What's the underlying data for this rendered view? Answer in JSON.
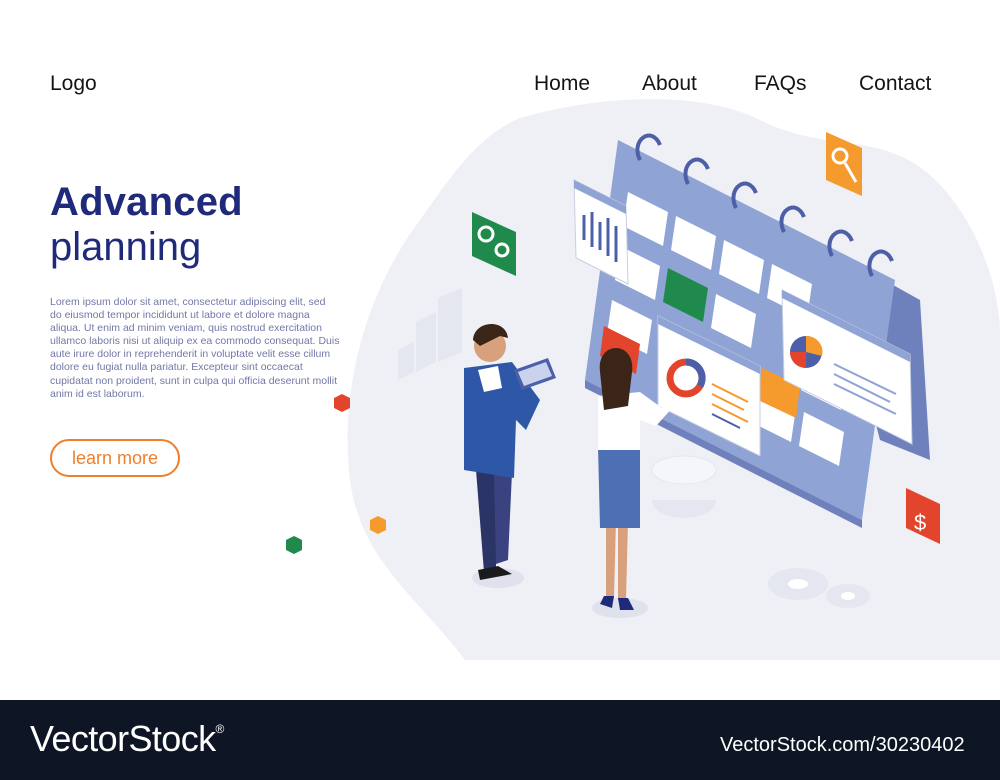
{
  "nav": {
    "logo": "Logo",
    "items": [
      "Home",
      "About",
      "FAQs",
      "Contact"
    ]
  },
  "hero": {
    "title_line1": "Advanced",
    "title_line2": "planning",
    "body": "Lorem ipsum dolor sit amet, consectetur adipiscing elit, sed do eiusmod tempor incididunt ut labore et dolore magna aliqua. Ut enim ad minim veniam, quis nostrud exercitation ullamco laboris nisi ut aliquip ex ea commodo consequat. Duis aute irure dolor in reprehenderit in voluptate velit esse cillum dolore eu fugiat nulla pariatur. Excepteur sint occaecat cupidatat non proident, sunt in culpa qui officia deserunt mollit anim id est laborum.",
    "button_label": "learn more"
  },
  "illustration": {
    "dollar_icon_label": "$"
  },
  "footer": {
    "watermark_left": "VectorStock",
    "registered_mark": "®",
    "watermark_right": "VectorStock.com/30230402"
  },
  "colors": {
    "title": "#1f2a7a",
    "accent": "#ef7f2c",
    "body_text": "#7278a6",
    "calendar": "#8fa3d4",
    "footer_bg": "#0e1524"
  }
}
